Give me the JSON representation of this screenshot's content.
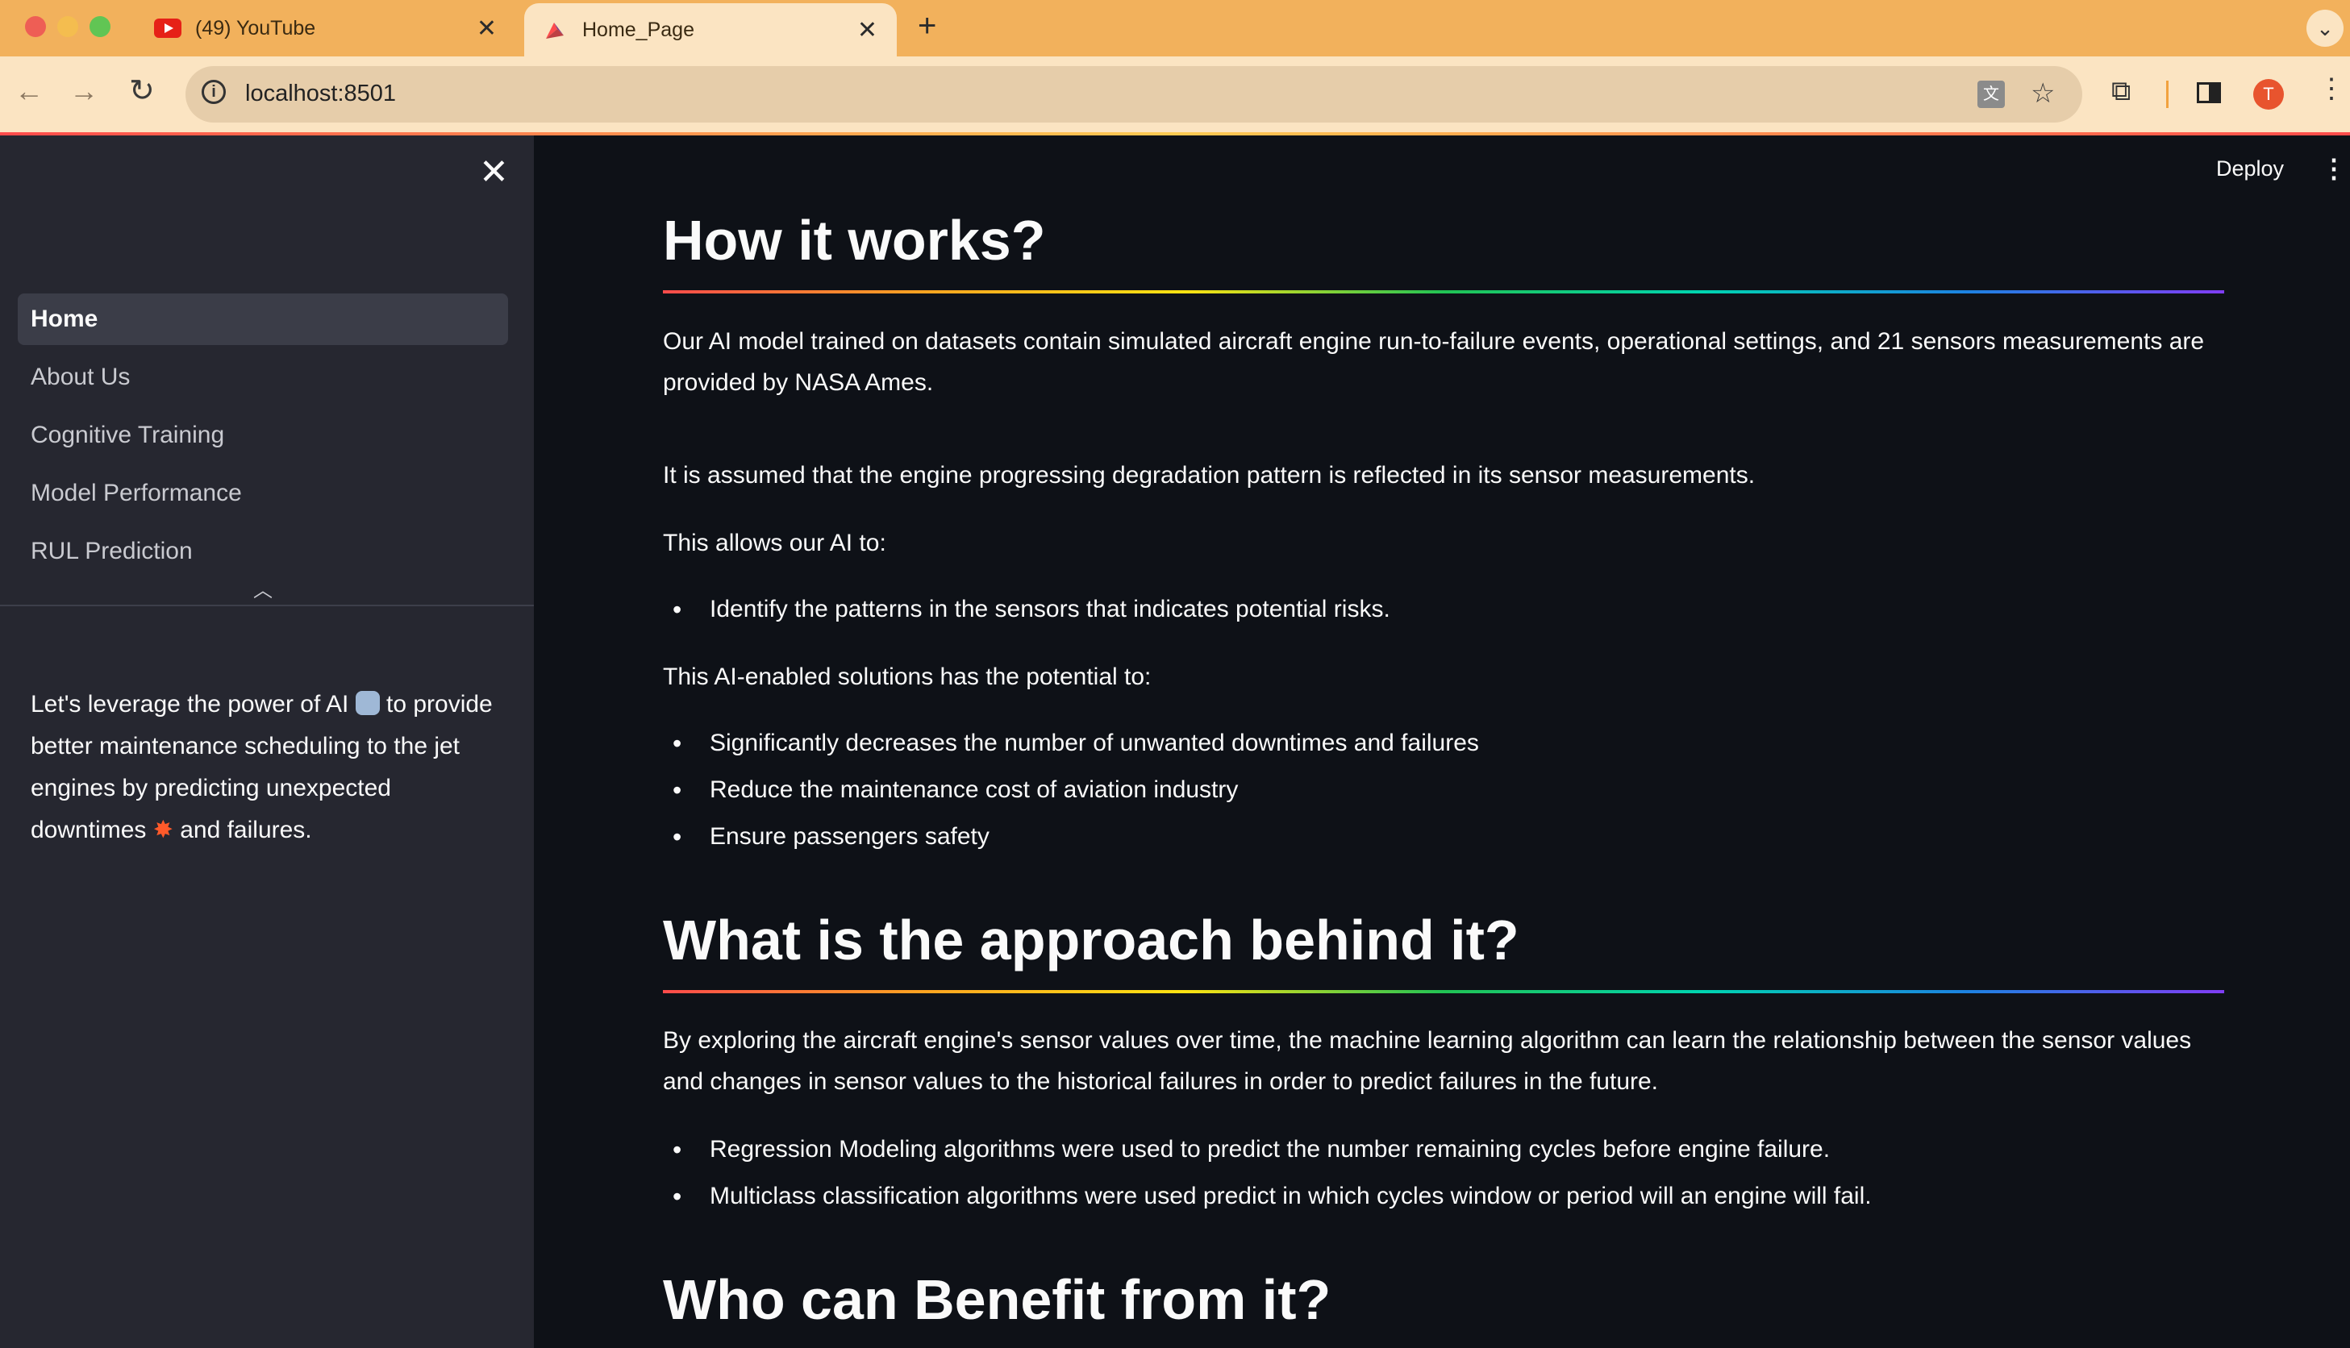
{
  "browser": {
    "tabs": [
      {
        "title": "(49) YouTube",
        "active": false,
        "favicon": "youtube-icon"
      },
      {
        "title": "Home_Page",
        "active": true,
        "favicon": "streamlit-icon"
      }
    ],
    "url": "localhost:8501",
    "profile_initial": "T",
    "colors": {
      "tabstrip": "#f2b15c",
      "toolbar": "#fbe4c2",
      "avatar": "#e8542e"
    }
  },
  "sidebar": {
    "items": [
      {
        "label": "Home",
        "active": true
      },
      {
        "label": "About Us",
        "active": false
      },
      {
        "label": "Cognitive Training",
        "active": false
      },
      {
        "label": "Model Performance",
        "active": false
      },
      {
        "label": "RUL Prediction",
        "active": false
      }
    ],
    "note": {
      "part1": "Let's leverage the power of AI ",
      "robot": "robot-emoji",
      "part2": " to provide better maintenance scheduling to the jet engines by predicting unexpected downtimes ",
      "boom": "✸",
      "part3": " and failures."
    }
  },
  "header": {
    "deploy_label": "Deploy"
  },
  "main": {
    "section1": {
      "title": "How it works?",
      "p1": "Our AI model trained on datasets contain simulated aircraft engine run-to-failure events, operational settings, and 21 sensors measurements are provided by NASA Ames.",
      "p2": "It is assumed that the engine progressing degradation pattern is reflected in its sensor measurements.",
      "p3": "This allows our AI to:",
      "bullets1": [
        "Identify the patterns in the sensors that indicates potential risks."
      ],
      "p4": "This AI-enabled solutions has the potential to:",
      "bullets2": [
        "Significantly decreases the number of unwanted downtimes and failures",
        "Reduce the maintenance cost of aviation industry",
        "Ensure passengers safety"
      ]
    },
    "section2": {
      "title": "What is the approach behind it?",
      "p1": "By exploring the aircraft engine's sensor values over time, the machine learning algorithm can learn the relationship between the sensor values and changes in sensor values to the historical failures in order to predict failures in the future.",
      "bullets": [
        "Regression Modeling algorithms were used to predict the number remaining cycles before engine failure.",
        "Multiclass classification algorithms were used predict in which cycles window or period will an engine will fail."
      ]
    },
    "section3": {
      "title": "Who can Benefit from it?"
    }
  }
}
